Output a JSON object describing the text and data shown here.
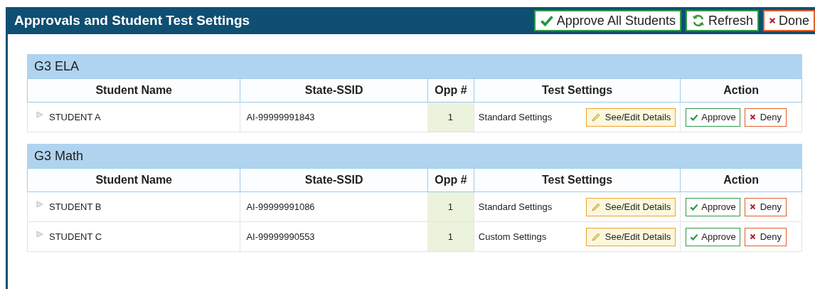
{
  "window": {
    "title": "Approvals and Student Test Settings"
  },
  "toolbar": [
    {
      "kind": "approve",
      "label": "Approve All Students"
    },
    {
      "kind": "refresh",
      "label": "Refresh"
    },
    {
      "kind": "close",
      "label": "Done"
    }
  ],
  "sections": [
    {
      "title": "G3 ELA",
      "columns": [
        "Student Name",
        "State-SSID",
        "Opp #",
        "Test Settings",
        "Action"
      ],
      "rows": [
        {
          "name": "STUDENT A",
          "ssid": "AI-99999991843",
          "opp": "1",
          "settings": "Standard Settings",
          "details": "See/Edit Details",
          "approve": "Approve",
          "deny": "Deny"
        }
      ]
    },
    {
      "title": "G3 Math",
      "columns": [
        "Student Name",
        "State-SSID",
        "Opp #",
        "Test Settings",
        "Action"
      ],
      "rows": [
        {
          "name": "STUDENT B",
          "ssid": "AI-99999991086",
          "opp": "1",
          "settings": "Standard Settings",
          "details": "See/Edit Details",
          "approve": "Approve",
          "deny": "Deny"
        },
        {
          "name": "STUDENT C",
          "ssid": "AI-99999990553",
          "opp": "1",
          "settings": "Custom Settings",
          "details": "See/Edit Details",
          "approve": "Approve",
          "deny": "Deny"
        }
      ]
    }
  ]
}
